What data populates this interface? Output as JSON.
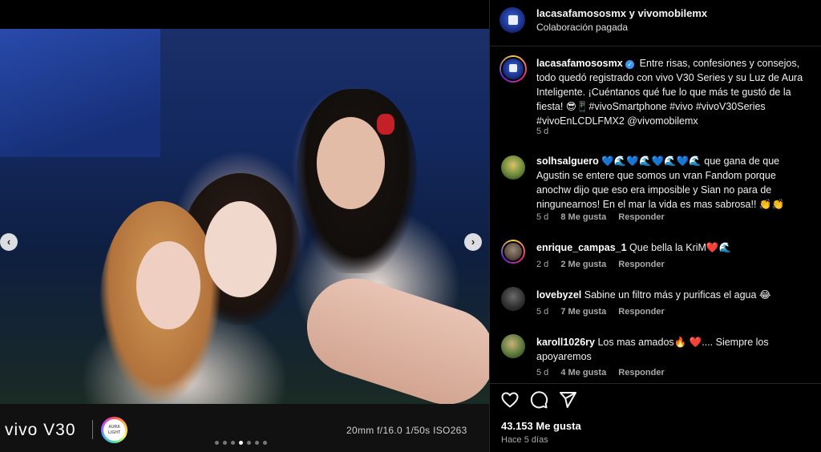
{
  "media": {
    "camera_brand": "vivo V30",
    "aura_badge": "AURA LIGHT",
    "camera_specs": "20mm  f/16.0  1/50s  ISO263",
    "prev_arrow": "‹",
    "next_arrow": "›",
    "carousel_total": 7,
    "carousel_active_index": 3
  },
  "header": {
    "names": "lacasafamososmx y vivomobilemx",
    "subtitle": "Colaboración pagada"
  },
  "caption": {
    "username": "lacasafamososmx",
    "text": "Entre risas, confesiones y consejos, todo quedó registrado con vivo V30 Series y su Luz de Aura Inteligente. ¡Cuéntanos qué fue lo que más te gustó de la fiesta! 😎📱#vivoSmartphone #vivo #vivoV30Series #vivoEnLCDLFMX2 @vivomobilemx",
    "age": "5 d"
  },
  "comments": [
    {
      "username": "solhsalguero",
      "text": "💙🌊💙🌊💙🌊💙🌊 que gana de que Agustin se entere que somos un vran Fandom porque anochw dijo que eso era imposible y Sian no para de ningunearnos! En el mar la vida es mas sabrosa!! 👏👏",
      "age": "5 d",
      "likes": "8 Me gusta",
      "reply": "Responder"
    },
    {
      "username": "enrique_campas_1",
      "text": "Que bella la KriM❤️🌊",
      "age": "2 d",
      "likes": "2 Me gusta",
      "reply": "Responder"
    },
    {
      "username": "lovebyzel",
      "text": "Sabine un filtro más y purificas el agua 😂",
      "age": "5 d",
      "likes": "7 Me gusta",
      "reply": "Responder"
    },
    {
      "username": "karoll1026ry",
      "text": "Los mas amados🔥 ❤️.... Siempre los apoyaremos",
      "age": "5 d",
      "likes": "4 Me gusta",
      "reply": "Responder"
    }
  ],
  "footer": {
    "likes": "43.153 Me gusta",
    "time_ago": "Hace 5 días"
  },
  "icons": [
    "heart-icon",
    "comment-icon",
    "share-icon",
    "chevron-left-icon",
    "chevron-right-icon",
    "verified-icon"
  ]
}
